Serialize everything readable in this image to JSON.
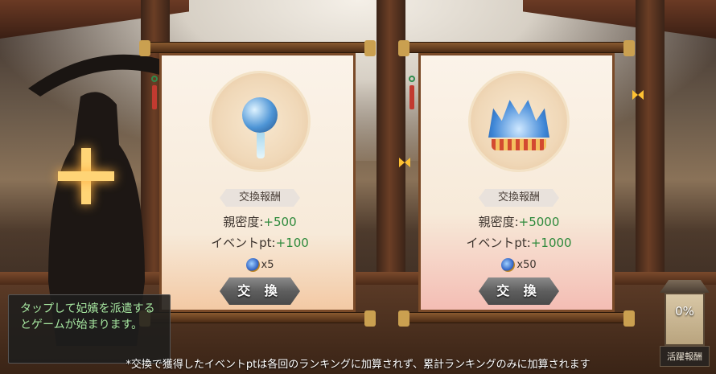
{
  "cards": [
    {
      "label": "交換報酬",
      "affection_label": "親密度:",
      "affection_value": "+500",
      "event_label": "イベントpt:",
      "event_value": "+100",
      "cost_value": "x5",
      "button_label": "交 換",
      "item_icon": "blue-orb-ornament-icon"
    },
    {
      "label": "交換報酬",
      "affection_label": "親密度:",
      "affection_value": "+5000",
      "event_label": "イベントpt:",
      "event_value": "+1000",
      "cost_value": "x50",
      "button_label": "交 換",
      "item_icon": "phoenix-crown-icon"
    }
  ],
  "hint": {
    "text": "タップして妃嬪を派遣するとゲームが始まります。"
  },
  "activity": {
    "percent": "0%",
    "caption": "活躍報酬"
  },
  "footer": {
    "note": "*交換で獲得したイベントptは各回のランキングに加算されず、累計ランキングのみに加算されます"
  },
  "colors": {
    "value_green": "#2e8a3c",
    "hint_green": "#a6e6a0",
    "glow": "#ffd476"
  }
}
